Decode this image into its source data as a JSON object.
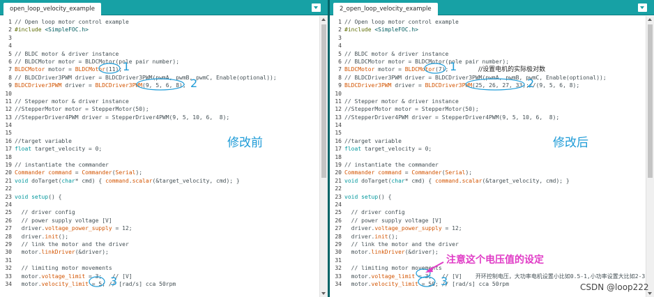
{
  "left": {
    "tab_label": "open_loop_velocity_example",
    "lines": [
      "// Open loop motor control example",
      "#include <SimpleFOC.h>",
      "",
      "",
      "// BLDC motor & driver instance",
      "// BLDCMotor motor = BLDCMotor(pole pair number);",
      "BLDCMotor motor = BLDCMotor(11);",
      "// BLDCDriver3PWM driver = BLDCDriver3PWM(pwmA, pwmB, pwmC, Enable(optional));",
      "BLDCDriver3PWM driver = BLDCDriver3PWM(9, 5, 6, 8);",
      "",
      "// Stepper motor & driver instance",
      "//StepperMotor motor = StepperMotor(50);",
      "//StepperDriver4PWM driver = StepperDriver4PWM(9, 5, 10, 6,  8);",
      "",
      "",
      "//target variable",
      "float target_velocity = 0;",
      "",
      "// instantiate the commander",
      "Commander command = Commander(Serial);",
      "void doTarget(char* cmd) { command.scalar(&target_velocity, cmd); }",
      "",
      "void setup() {",
      "",
      "  // driver config",
      "  // power supply voltage [V]",
      "  driver.voltage_power_supply = 12;",
      "  driver.init();",
      "  // link the motor and the driver",
      "  motor.linkDriver(&driver);",
      "",
      "  // limiting motor movements",
      "  motor.voltage_limit = 3;   // [V]",
      "  motor.velocity_limit = 5; // [rad/s] cca 50rpm"
    ]
  },
  "right": {
    "tab_label": "2_open_loop_velocity_example",
    "lines": [
      "// Open loop motor control example",
      "#include <SimpleFOC.h>",
      "",
      "",
      "// BLDC motor & driver instance",
      "// BLDCMotor motor = BLDCMotor(pole pair number);",
      "BLDCMotor motor = BLDCMotor(7);",
      "// BLDCDriver3PWM driver = BLDCDriver3PWM(pwmA, pwmB, pwmC, Enable(optional));",
      "BLDCDriver3PWM driver = BLDCDriver3PWM(25, 26, 27, 33);//(9, 5, 6, 8);",
      "",
      "// Stepper motor & driver instance",
      "//StepperMotor motor = StepperMotor(50);",
      "//StepperDriver4PWM driver = StepperDriver4PWM(9, 5, 10, 6,  8);",
      "",
      "",
      "//target variable",
      "float target_velocity = 0;",
      "",
      "// instantiate the commander",
      "Commander command = Commander(Serial);",
      "void doTarget(char* cmd) { command.scalar(&target_velocity, cmd); }",
      "",
      "void setup() {",
      "",
      "  // driver config",
      "  // power supply voltage [V]",
      "  driver.voltage_power_supply = 12;",
      "  driver.init();",
      "  // link the motor and the driver",
      "  motor.linkDriver(&driver);",
      "",
      "  // limiting motor movements",
      "  motor.voltage_limit = 3;   // [V]    开环控制电压，大功率电机设置小比如0.5-1,小功率设置大比如2-3,",
      "  motor.velocity_limit = 50; // [rad/s] cca 50rpm"
    ]
  },
  "annotations": {
    "before": "修改前",
    "after": "修改后",
    "label_1": "1",
    "label_2": "2",
    "label_3": "3",
    "pole_note": "//设置电机的实际极对数",
    "voltage_note": "注意这个电压值的设定",
    "watermark": "CSDN @loop222"
  },
  "colors": {
    "tab_bar": "#17a1a5",
    "annotation_blue": "#1e9bd7",
    "annotation_pink": "#e03cc6",
    "keyword": "#00979c",
    "type": "#d35400"
  }
}
